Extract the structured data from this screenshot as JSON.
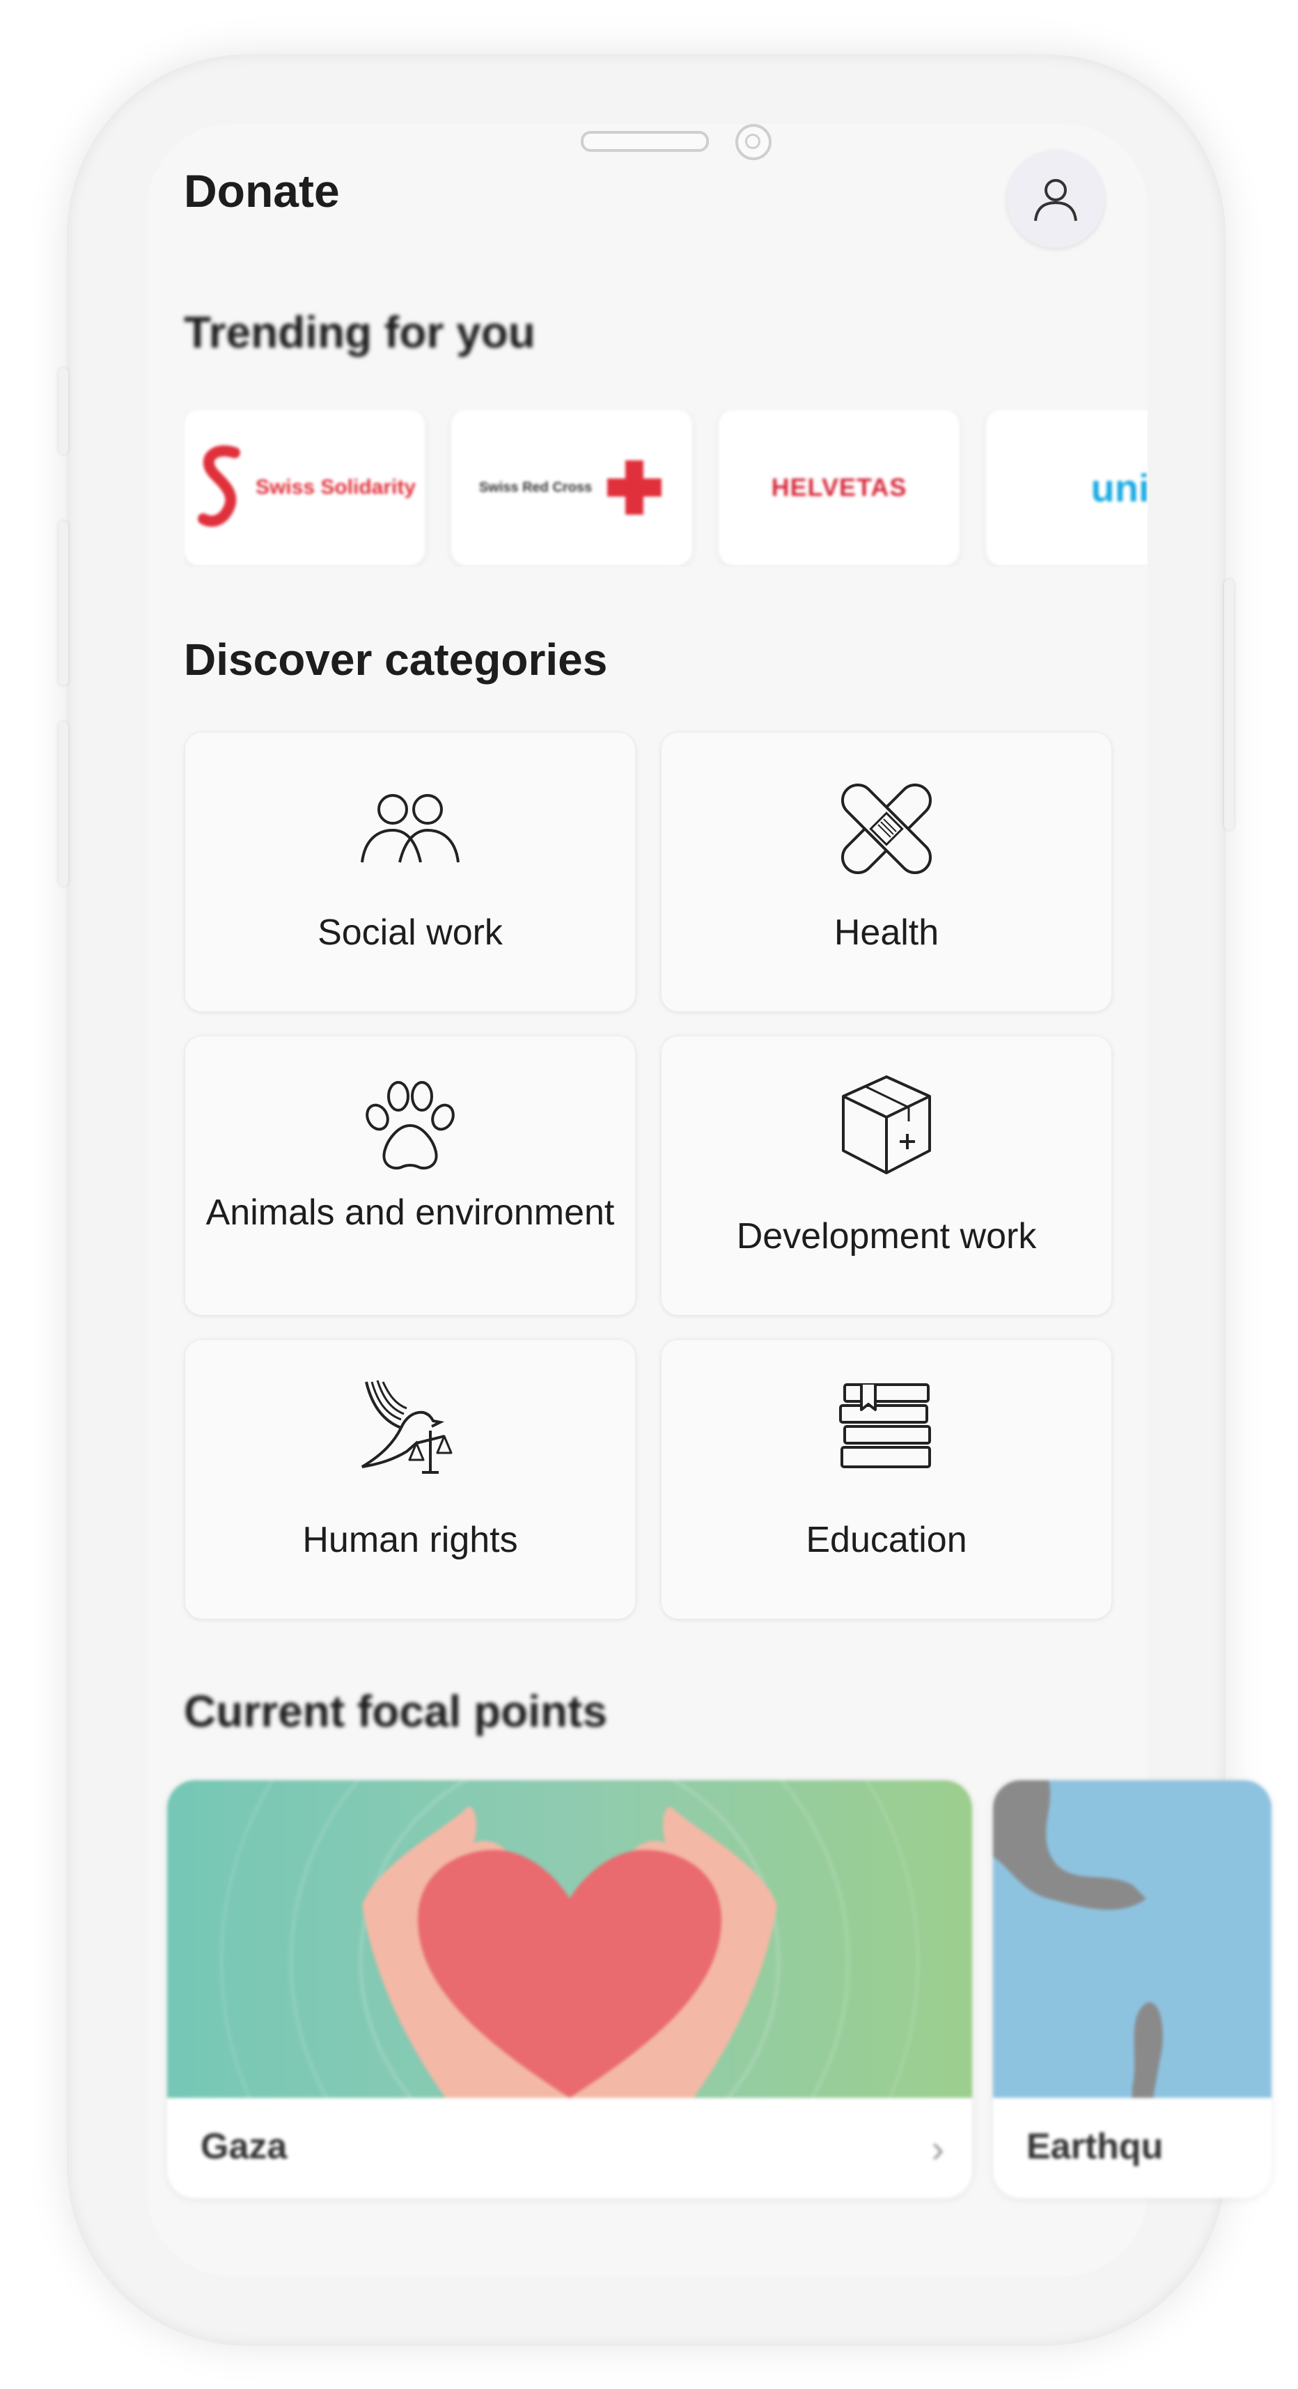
{
  "app": {
    "title": "Donate"
  },
  "profile": {
    "icon": "user-icon"
  },
  "trending": {
    "heading": "Trending for you",
    "items": [
      {
        "name": "Swiss Solidarity",
        "color": "#e0303c"
      },
      {
        "name": "Swiss Red Cross",
        "color": "#e0303c"
      },
      {
        "name": "HELVETAS",
        "color": "#d7283b"
      },
      {
        "name": "unicef",
        "color": "#1cabe2"
      }
    ]
  },
  "categories": {
    "heading": "Discover categories",
    "items": [
      {
        "label": "Social work",
        "icon": "people-icon"
      },
      {
        "label": "Health",
        "icon": "bandage-icon"
      },
      {
        "label": "Animals and environment",
        "icon": "paw-icon"
      },
      {
        "label": "Development work",
        "icon": "box-icon"
      },
      {
        "label": "Human rights",
        "icon": "dove-scales-icon"
      },
      {
        "label": "Education",
        "icon": "books-icon"
      }
    ]
  },
  "focal": {
    "heading": "Current focal points",
    "items": [
      {
        "label": "Gaza"
      },
      {
        "label": "Earthqu"
      }
    ]
  }
}
